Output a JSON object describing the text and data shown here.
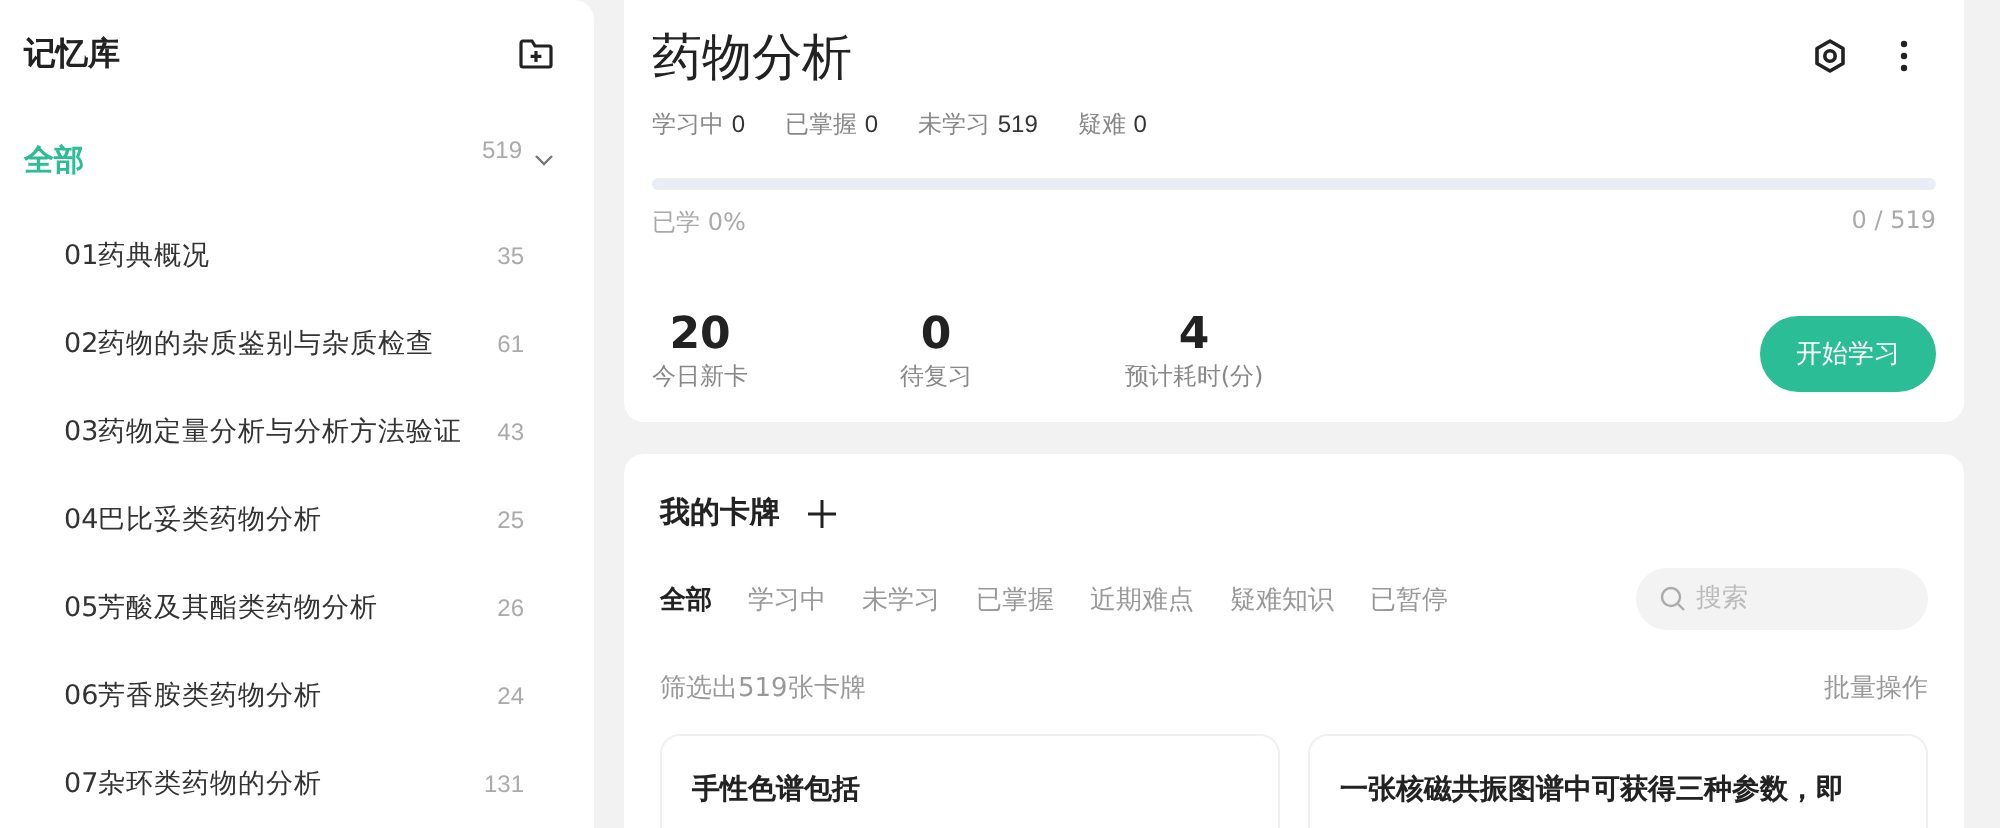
{
  "sidebar": {
    "title": "记忆库",
    "root": {
      "label": "全部",
      "count": "519",
      "selected": true,
      "expanded": true,
      "children": [
        {
          "label": "01药典概况",
          "count": "35",
          "selected": false
        },
        {
          "label": "02药物的杂质鉴别与杂质检查",
          "count": "61",
          "selected": false
        },
        {
          "label": "03药物定量分析与分析方法验证",
          "count": "43",
          "selected": false
        },
        {
          "label": "04巴比妥类药物分析",
          "count": "25",
          "selected": false
        },
        {
          "label": "05芳酸及其酯类药物分析",
          "count": "26",
          "selected": false
        },
        {
          "label": "06芳香胺类药物分析",
          "count": "24",
          "selected": false
        },
        {
          "label": "07杂环类药物的分析",
          "count": "131",
          "selected": false
        }
      ]
    }
  },
  "deck": {
    "title": "药物分析",
    "stats": [
      {
        "label": "学习中",
        "value": "0"
      },
      {
        "label": "已掌握",
        "value": "0"
      },
      {
        "label": "未学习",
        "value": "519"
      },
      {
        "label": "疑难",
        "value": "0"
      }
    ],
    "progress": {
      "caption": "已学 0%",
      "reading": "0 / 519"
    },
    "summary": [
      {
        "value": "20",
        "label": "今日新卡"
      },
      {
        "value": "0",
        "label": "待复习"
      },
      {
        "value": "4",
        "label": "预计耗时(分)"
      }
    ],
    "start_button": "开始学习"
  },
  "cards": {
    "title": "我的卡牌",
    "tabs": [
      {
        "label": "全部",
        "selected": true
      },
      {
        "label": "学习中",
        "selected": false
      },
      {
        "label": "未学习",
        "selected": false
      },
      {
        "label": "已掌握",
        "selected": false
      },
      {
        "label": "近期难点",
        "selected": false
      },
      {
        "label": "疑难知识",
        "selected": false
      },
      {
        "label": "已暂停",
        "selected": false
      }
    ],
    "search": {
      "placeholder": "搜索"
    },
    "filter_text": "筛选出519张卡牌",
    "batch_action": "批量操作",
    "items": [
      {
        "title": "手性色谱包括"
      },
      {
        "title": "一张核磁共振图谱中可获得三种参数，即"
      }
    ]
  }
}
